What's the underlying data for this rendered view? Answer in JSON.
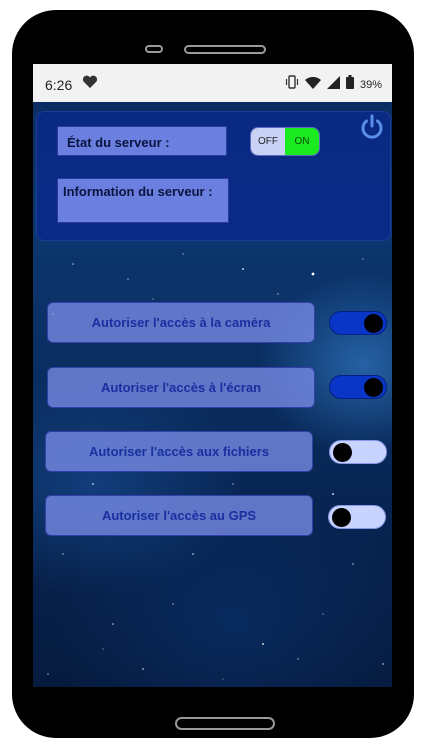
{
  "status_bar": {
    "time": "6:26",
    "battery_percent": "39%"
  },
  "server_panel": {
    "state_label": "État du serveur :",
    "toggle_off": "OFF",
    "toggle_on": "ON",
    "toggle_state": "on",
    "info_label": "Information du serveur :"
  },
  "permissions": [
    {
      "label": "Autoriser l'accès à la caméra",
      "enabled": true
    },
    {
      "label": "Autoriser l'accès à l'écran",
      "enabled": true
    },
    {
      "label": "Autoriser l'accès aux fichiers",
      "enabled": false
    },
    {
      "label": "Autoriser l'accès au GPS",
      "enabled": false
    }
  ],
  "colors": {
    "toggle_on_green": "#1bea20",
    "switch_on": "#0a36c8",
    "power_icon": "#5b8ee8"
  },
  "icons": [
    "heart-icon",
    "vibrate-icon",
    "wifi-icon",
    "signal-icon",
    "battery-icon",
    "power-icon"
  ]
}
